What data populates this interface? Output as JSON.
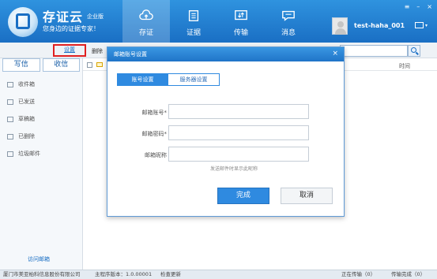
{
  "header": {
    "brand": "存证云",
    "brand_sub": "企业版",
    "slogan": "您身边的证据专家！",
    "nav": [
      {
        "label": "存证",
        "icon": "cloud-upload-icon"
      },
      {
        "label": "证据",
        "icon": "document-icon"
      },
      {
        "label": "传输",
        "icon": "transfer-icon"
      },
      {
        "label": "消息",
        "icon": "message-icon"
      }
    ],
    "username": "test-haha_001",
    "active_nav": "存证"
  },
  "toolbar": {
    "settings_label": "设置",
    "delete_label": "删除"
  },
  "sidebar": {
    "compose_label": "写信",
    "receive_label": "收信",
    "folders": [
      {
        "label": "收件箱",
        "icon": "inbox-icon"
      },
      {
        "label": "已发送",
        "icon": "sent-icon"
      },
      {
        "label": "草稿箱",
        "icon": "draft-icon"
      },
      {
        "label": "已删除",
        "icon": "trash-icon"
      },
      {
        "label": "垃圾邮件",
        "icon": "spam-icon"
      }
    ],
    "visit_mail": "访问邮箱"
  },
  "list": {
    "time_header": "时间"
  },
  "modal": {
    "title": "邮箱账号设置",
    "close": "×",
    "tabs": [
      "账号设置",
      "服务器设置"
    ],
    "fields": [
      {
        "label": "邮箱账号*",
        "value": ""
      },
      {
        "label": "邮箱密码*",
        "value": ""
      },
      {
        "label": "邮箱昵称",
        "value": ""
      }
    ],
    "hint": "发送邮件时显示此昵称",
    "confirm_label": "完成",
    "cancel_label": "取消"
  },
  "statusbar": {
    "company": "厦门市美亚柏科信息股份有限公司",
    "version": "主程序版本：1.0.00001",
    "update": "检查更新",
    "transfer": "正在传输（0）",
    "done": "传输完成（0）"
  },
  "colors": {
    "header_blue": "#1a6fc4",
    "accent_blue": "#2f8ae0",
    "highlight_red": "#e02020"
  }
}
